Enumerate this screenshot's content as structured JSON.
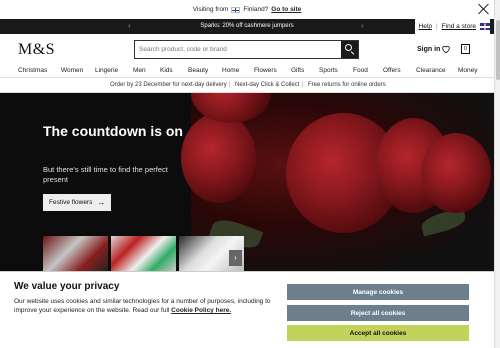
{
  "country_bar": {
    "visiting_from": "Visiting from",
    "country": "Finland?",
    "goto": "Go to site"
  },
  "promo_bar": {
    "message": "Sparks: 20% off cashmere jumpers",
    "prev_arrow": "‹",
    "next_arrow": "›",
    "help": "Help",
    "find_store": "Find a store",
    "separator": "|"
  },
  "header": {
    "logo": "M&S",
    "search_placeholder": "Search product, code or brand",
    "signin": "Sign in",
    "bag_count": "0"
  },
  "nav": {
    "items": [
      "Christmas",
      "Women",
      "Lingerie",
      "Men",
      "Kids",
      "Beauty",
      "Home",
      "Flowers",
      "Gifts",
      "Sports",
      "Food",
      "Offers",
      "Clearance",
      "Money"
    ]
  },
  "info": {
    "items": [
      "Order by 23 December for next-day delivery",
      "Next-day Click & Collect",
      "Free returns for online orders"
    ],
    "separator": "|"
  },
  "hero": {
    "title": "The countdown is on",
    "subtitle": "But there's still time to find the perfect present",
    "button": "Festive flowers",
    "button_arrow": "→",
    "thumb_arrow": "›"
  },
  "cookie": {
    "title": "We value your privacy",
    "body": "Our website uses cookies and similar technologies for a number of purposes, including to improve your experience on the website. Read our full ",
    "policy_link": "Cookie Policy here.",
    "manage": "Manage cookies",
    "reject": "Reject all cookies",
    "accept": "Accept all cookies"
  }
}
